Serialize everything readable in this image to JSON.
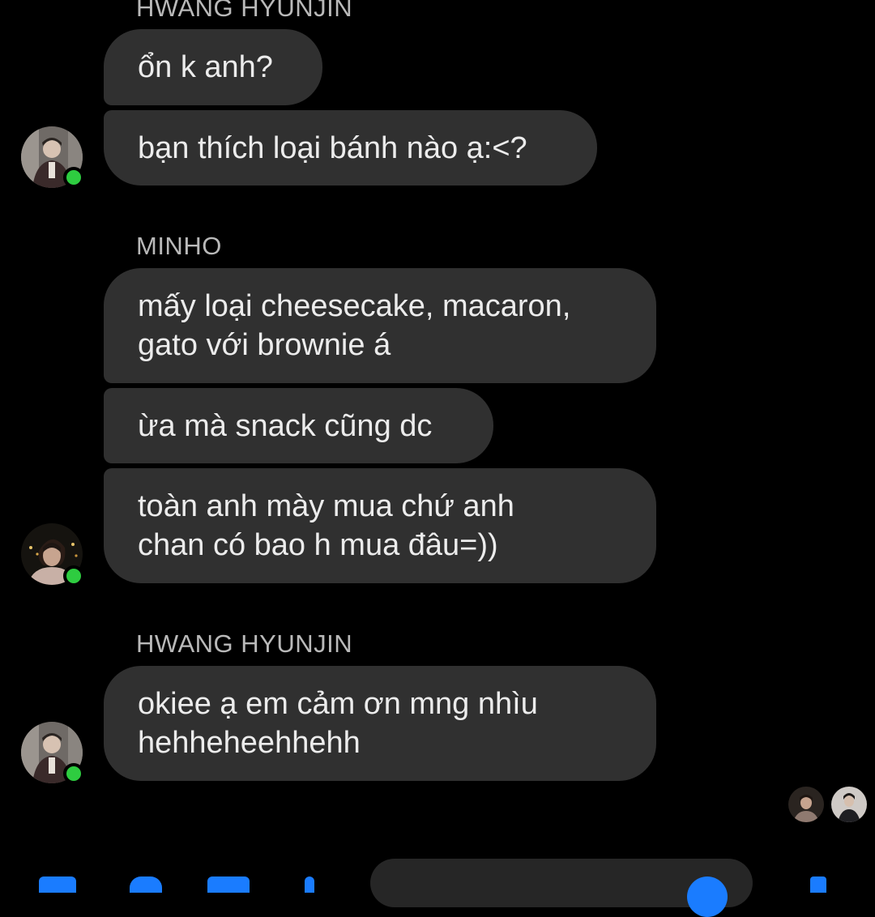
{
  "conversation": {
    "groups": [
      {
        "sender": "HWANG HYUNJIN",
        "messages": [
          "ổn k anh?",
          "bạn thích loại bánh nào ạ:<?"
        ]
      },
      {
        "sender": "MINHO",
        "messages": [
          "mấy loại cheesecake, macaron,",
          "gato với brownie á",
          "ừa mà snack cũng dc",
          "toàn anh mày mua chứ anh",
          "chan có bao h mua đâu=))"
        ]
      },
      {
        "sender": "HWANG HYUNJIN",
        "messages": [
          "okiee ạ em cảm ơn mng nhìu",
          "hehheheehhehh"
        ]
      }
    ]
  },
  "seen_by": [
    "avatar-1",
    "avatar-2"
  ],
  "composer": {
    "icons": [
      "menu-icon",
      "camera-icon",
      "gallery-icon",
      "mic-icon",
      "emoji-icon",
      "like-icon"
    ]
  },
  "colors": {
    "background": "#000000",
    "bubble": "#303030",
    "sender_label": "#b9b9b9",
    "online": "#2ecc40",
    "accent": "#1a7cff"
  }
}
